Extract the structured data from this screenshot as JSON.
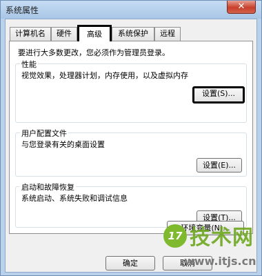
{
  "window": {
    "title": "系统属性",
    "close_glyph": "✕"
  },
  "tabs": [
    {
      "label": "计算机名"
    },
    {
      "label": "硬件"
    },
    {
      "label": "高级",
      "active": true
    },
    {
      "label": "系统保护"
    },
    {
      "label": "远程"
    }
  ],
  "panel": {
    "admin_note": "要进行大多数更改，您必须作为管理员登录。",
    "performance": {
      "title": "性能",
      "description": "视觉效果，处理器计划，内存使用，以及虚拟内存",
      "button": "设置(S)..."
    },
    "user_profiles": {
      "title": "用户配置文件",
      "description": "与您登录有关的桌面设置",
      "button": "设置(E)..."
    },
    "startup_recovery": {
      "title": "启动和故障恢复",
      "description": "系统启动、系统失败和调试信息",
      "button": "设置(T)..."
    },
    "env_button": "环境变量(N)..."
  },
  "footer": {
    "ok": "确定",
    "cancel": "取消"
  },
  "watermark": {
    "logo": "17",
    "title": "技术网",
    "url": "www.itjs.cn"
  },
  "colors": {
    "accent_green": "#6fa820",
    "highlight_border": "#000000"
  }
}
